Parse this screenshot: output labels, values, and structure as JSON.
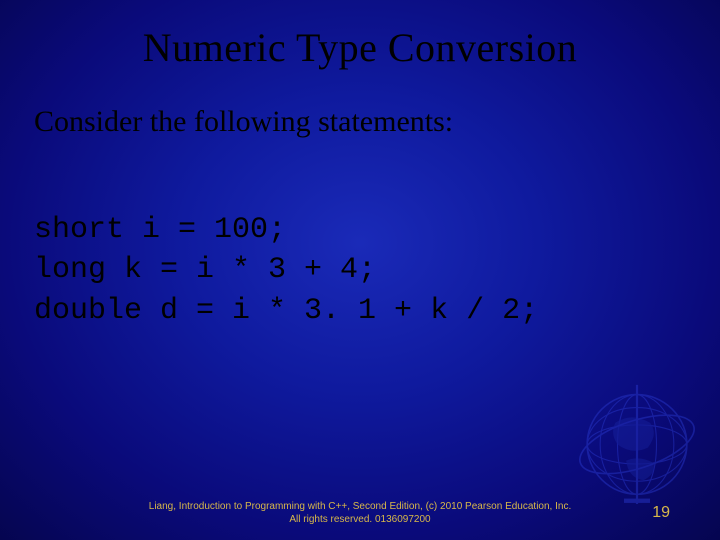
{
  "slide": {
    "title": "Numeric Type Conversion",
    "intro": "Consider the following statements:",
    "code_lines": [
      "short i = 100;",
      "long k = i * 3 + 4;",
      "double d = i * 3. 1 + k / 2;"
    ],
    "footer_line1": "Liang, Introduction to Programming with C++, Second Edition, (c) 2010 Pearson Education, Inc.",
    "footer_line2": "All rights reserved. 0136097200",
    "page_number": "19"
  }
}
